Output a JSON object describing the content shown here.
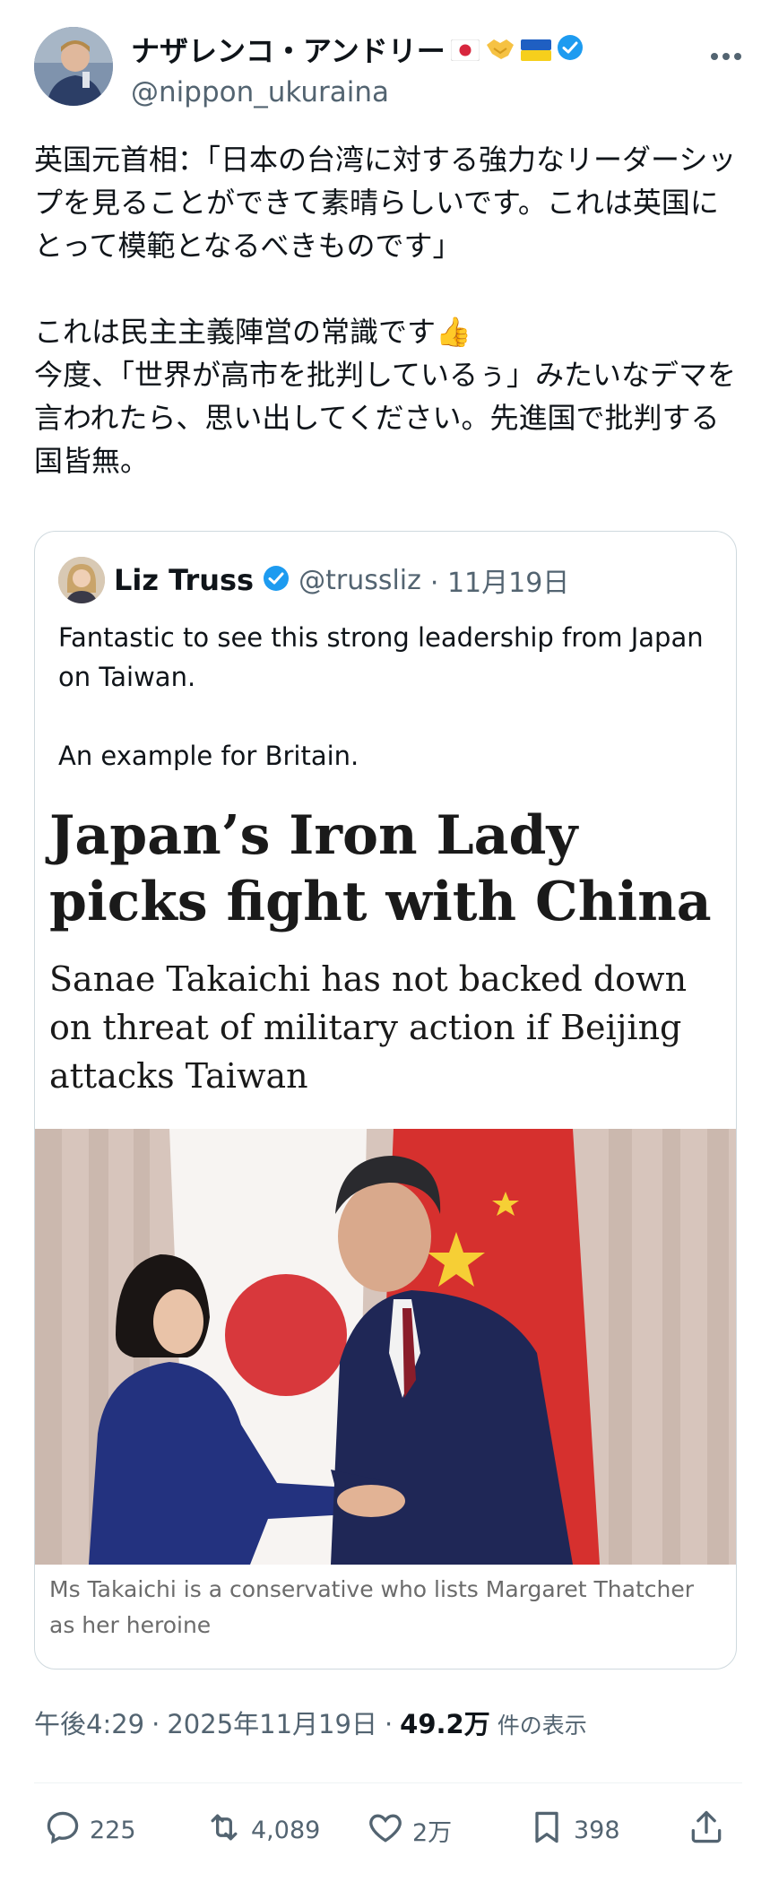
{
  "author": {
    "display_name": "ナザレンコ・アンドリー",
    "handle": "@nippon_ukuraina",
    "badges": [
      "japan-flag-icon",
      "handshake-icon",
      "ukraine-flag-icon",
      "verified-icon"
    ]
  },
  "post": {
    "text": "英国元首相：「日本の台湾に対する強力なリーダーシップを見ることができて素晴らしいです。これは英国にとって模範となるべきものです」\n\nこれは民主主義陣営の常識です👍\n今度、「世界が高市を批判しているぅ」みたいなデマを言われたら、思い出してください。先進国で批判する国皆無。"
  },
  "quote": {
    "name": "Liz Truss",
    "handle": "@trussliz",
    "date": "· 11月19日",
    "text": "Fantastic to see this strong leadership from Japan on Taiwan.\n\nAn example for Britain.",
    "article": {
      "headline": "Japan’s Iron Lady picks fight with China",
      "subhead": "Sanae Takaichi has not backed down on threat of military action if Beijing attacks Taiwan",
      "caption": "Ms Takaichi is a conservative who lists Margaret Thatcher as her heroine"
    }
  },
  "meta": {
    "time": "午後4:29",
    "sep1": "·",
    "date": "2025年11月19日",
    "sep2": "·",
    "views": "49.2万",
    "views_label": "件の表示"
  },
  "actions": {
    "replies": "225",
    "reposts": "4,089",
    "likes": "2万",
    "bookmarks": "398"
  },
  "colors": {
    "text": "#0f1419",
    "secondary": "#536471",
    "verified": "#1d9bf0",
    "border": "#cfd9de"
  }
}
